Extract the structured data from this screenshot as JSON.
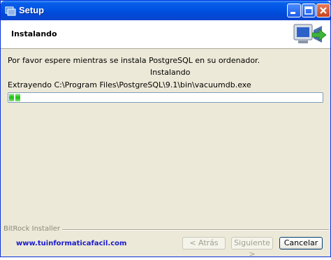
{
  "window": {
    "title": "Setup"
  },
  "header": {
    "title": "Instalando"
  },
  "content": {
    "message": "Por favor espere mientras se instala PostgreSQL en su ordenador.",
    "status": "Instalando",
    "extracting": "Extrayendo C:\\Program Files\\PostgreSQL\\9.1\\bin\\vacuumdb.exe",
    "progress_fraction": 0.04,
    "progress_color": "#26c31b"
  },
  "footer": {
    "installer_label": "BitRock Installer",
    "website": "www.tuinformaticafacil.com",
    "back_label": "< Atrás",
    "next_label": "Siguiente >",
    "cancel_label": "Cancelar"
  }
}
